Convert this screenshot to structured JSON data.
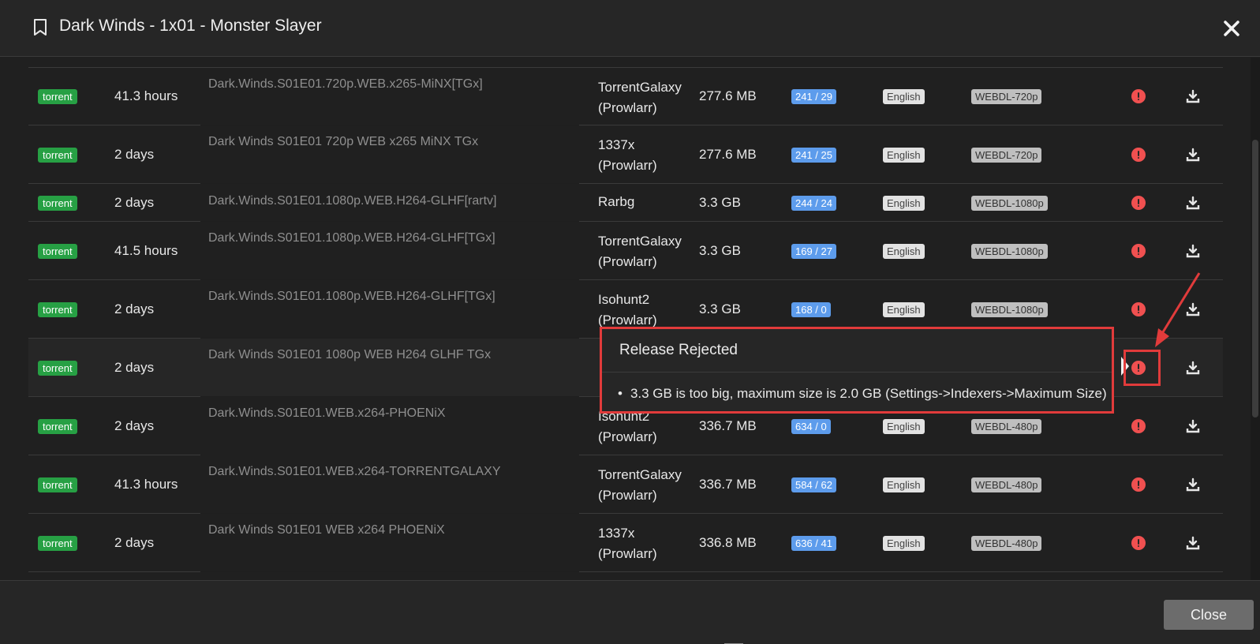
{
  "header": {
    "title": "Dark Winds - 1x01 - Monster Slayer",
    "icon": "bookmark-icon",
    "close_icon": "close-icon"
  },
  "rows": [
    {
      "protocol": "torrent",
      "age": "41.3 hours",
      "title": "Dark.Winds.S01E01.720p.WEB.x265-MiNX[TGx]",
      "indexer1": "TorrentGalaxy",
      "indexer2": "(Prowlarr)",
      "size": "277.6 MB",
      "peers": "241 / 29",
      "language": "English",
      "quality": "WEBDL-720p"
    },
    {
      "protocol": "torrent",
      "age": "2 days",
      "title": "Dark Winds S01E01 720p WEB x265 MiNX TGx",
      "indexer1": "1337x",
      "indexer2": "(Prowlarr)",
      "size": "277.6 MB",
      "peers": "241 / 25",
      "language": "English",
      "quality": "WEBDL-720p"
    },
    {
      "protocol": "torrent",
      "age": "2 days",
      "title": "Dark.Winds.S01E01.1080p.WEB.H264-GLHF[rartv]",
      "indexer1": "Rarbg",
      "indexer2": "",
      "size": "3.3 GB",
      "peers": "244 / 24",
      "language": "English",
      "quality": "WEBDL-1080p"
    },
    {
      "protocol": "torrent",
      "age": "41.5 hours",
      "title": "Dark.Winds.S01E01.1080p.WEB.H264-GLHF[TGx]",
      "indexer1": "TorrentGalaxy",
      "indexer2": "(Prowlarr)",
      "size": "3.3 GB",
      "peers": "169 / 27",
      "language": "English",
      "quality": "WEBDL-1080p"
    },
    {
      "protocol": "torrent",
      "age": "2 days",
      "title": "Dark.Winds.S01E01.1080p.WEB.H264-GLHF[TGx]",
      "indexer1": "Isohunt2",
      "indexer2": "(Prowlarr)",
      "size": "3.3 GB",
      "peers": "168 / 0",
      "language": "English",
      "quality": "WEBDL-1080p"
    },
    {
      "protocol": "torrent",
      "age": "2 days",
      "title": "Dark Winds S01E01 1080p WEB H264 GLHF TGx",
      "indexer1": "",
      "indexer2": "",
      "size": "",
      "peers": "",
      "language": "",
      "quality": ""
    },
    {
      "protocol": "torrent",
      "age": "2 days",
      "title": "Dark.Winds.S01E01.WEB.x264-PHOENiX",
      "indexer1": "Isohunt2",
      "indexer2": "(Prowlarr)",
      "size": "336.7 MB",
      "peers": "634 / 0",
      "language": "English",
      "quality": "WEBDL-480p"
    },
    {
      "protocol": "torrent",
      "age": "41.3 hours",
      "title": "Dark.Winds.S01E01.WEB.x264-TORRENTGALAXY",
      "indexer1": "TorrentGalaxy",
      "indexer2": "(Prowlarr)",
      "size": "336.7 MB",
      "peers": "584 / 62",
      "language": "English",
      "quality": "WEBDL-480p"
    },
    {
      "protocol": "torrent",
      "age": "2 days",
      "title": "Dark Winds S01E01 WEB x264 PHOENiX",
      "indexer1": "1337x",
      "indexer2": "(Prowlarr)",
      "size": "336.8 MB",
      "peers": "636 / 41",
      "language": "English",
      "quality": "WEBDL-480p"
    }
  ],
  "popover": {
    "title": "Release Rejected",
    "reason": "3.3 GB is too big, maximum size is 2.0 GB (Settings->Indexers->Maximum Size)"
  },
  "footer": {
    "close_label": "Close"
  },
  "colors": {
    "torrent": "#27a044",
    "peers": "#5d9cec",
    "rejected": "#f05050",
    "annotation": "#e13b3b"
  }
}
